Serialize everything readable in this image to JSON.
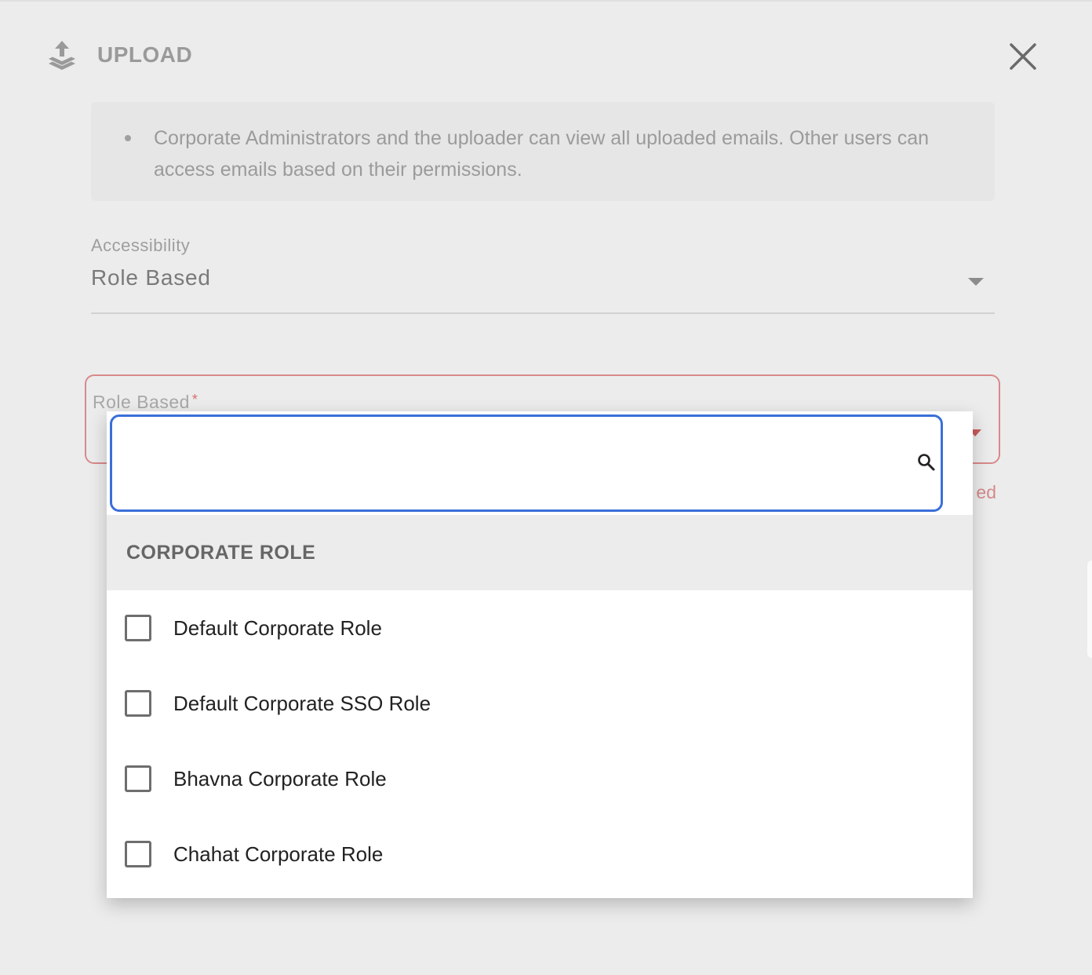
{
  "header": {
    "title": "UPLOAD",
    "icon": "upload-icon",
    "close_icon": "close-icon"
  },
  "info": {
    "bullets": [
      "Corporate Administrators and the uploader can view all uploaded emails. Other users can access emails based on their permissions."
    ]
  },
  "accessibility": {
    "label": "Accessibility",
    "value": "Role Based"
  },
  "role_field": {
    "label": "Role Based",
    "required_mark": "*",
    "error_fragment": "ed"
  },
  "dropdown": {
    "search_value": "",
    "search_placeholder": "",
    "search_icon": "search-icon",
    "group_label": "CORPORATE ROLE",
    "options": [
      {
        "label": "Default Corporate Role",
        "checked": false
      },
      {
        "label": "Default Corporate SSO Role",
        "checked": false
      },
      {
        "label": "Bhavna Corporate Role",
        "checked": false
      },
      {
        "label": "Chahat Corporate Role",
        "checked": false
      }
    ]
  },
  "colors": {
    "accent": "#3a6fd8",
    "error": "#d88a8a",
    "background": "#ececec"
  }
}
